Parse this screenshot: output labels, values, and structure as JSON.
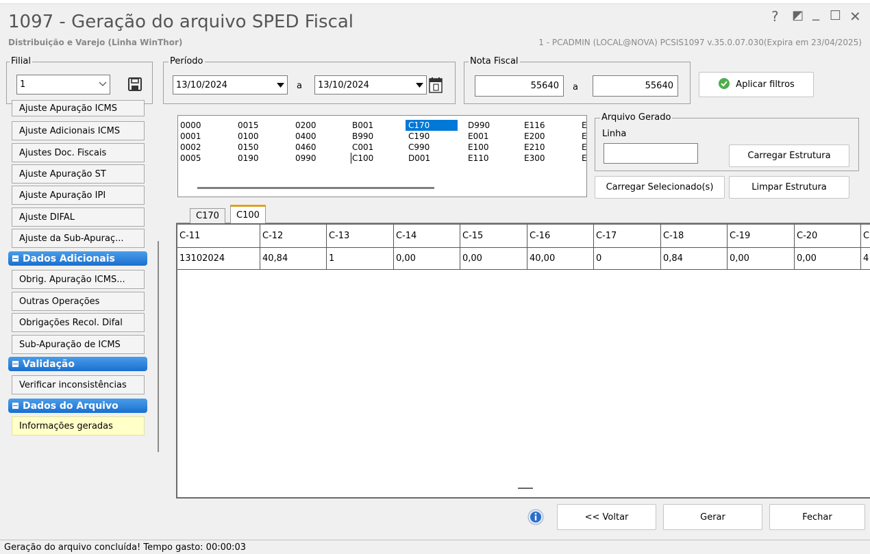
{
  "window": {
    "title": "1097 - Geração do arquivo SPED Fiscal",
    "subtitle": "Distribuição e Varejo (Linha WinThor)",
    "sysinfo": "1 - PCADMIN (LOCAL@NOVA)   PCSIS1097  v.35.0.07.030(Expira em 23/04/2025)",
    "controls": {
      "help": "?",
      "restore": "◩",
      "minimize": "_",
      "maximize": "☐",
      "close": "✕"
    }
  },
  "filial": {
    "legend": "Filial",
    "value": "1"
  },
  "periodo": {
    "legend": "Período",
    "start": "13/10/2024",
    "sep": "a",
    "end": "13/10/2024"
  },
  "nota": {
    "legend": "Nota Fiscal",
    "start": "55640",
    "sep": "a",
    "end": "55640"
  },
  "apply_button": "Aplicar filtros",
  "sidebar": {
    "items_top": [
      "Ajuste Apuração ICMS",
      "Ajuste Adicionais ICMS",
      "Ajustes Doc. Fiscais",
      "Ajuste Apuração ST",
      "Ajuste Apuração IPI",
      "Ajuste DIFAL",
      "Ajuste da Sub-Apuraç..."
    ],
    "head_adicionais": "Dados Adicionais",
    "items_adicionais": [
      "Obrig. Apuração ICMS...",
      "Outras Operações",
      "Obrigações Recol. Difal",
      "Sub-Apuração de ICMS"
    ],
    "head_validacao": "Validação",
    "item_validacao": "Verificar inconsistências",
    "head_arquivo": "Dados do Arquivo",
    "item_arquivo": "Informações geradas"
  },
  "records": {
    "columns": [
      [
        "0000",
        "0001",
        "0002",
        "0005"
      ],
      [
        "0015",
        "0100",
        "0150",
        "0190"
      ],
      [
        "0200",
        "0400",
        "0460",
        "0990"
      ],
      [
        "B001",
        "B990",
        "C001",
        "C100"
      ],
      [
        "C170",
        "C190",
        "C990",
        "D001"
      ],
      [
        "D990",
        "E001",
        "E100",
        "E110"
      ],
      [
        "E116",
        "E200",
        "E210",
        "E300"
      ],
      [
        "E",
        "E",
        "E",
        "E"
      ]
    ],
    "selected": "C170"
  },
  "arquivo_gerado": {
    "legend": "Arquivo Gerado",
    "linha_label": "Linha",
    "linha_value": ""
  },
  "buttons": {
    "carregar_estrutura": "Carregar Estrutura",
    "carregar_selecionados": "Carregar Selecionado(s)",
    "limpar_estrutura": "Limpar Estrutura",
    "voltar": "<< Voltar",
    "gerar": "Gerar",
    "fechar": "Fechar"
  },
  "tabs": [
    "C170",
    "C100"
  ],
  "grid": {
    "headers": [
      "C-11",
      "C-12",
      "C-13",
      "C-14",
      "C-15",
      "C-16",
      "C-17",
      "C-18",
      "C-19",
      "C-20",
      "C"
    ],
    "rows": [
      [
        "13102024",
        "40,84",
        "1",
        "0,00",
        "0,00",
        "40,00",
        "0",
        "0,84",
        "0,00",
        "0,00",
        "4"
      ]
    ]
  },
  "status": "Geração do arquivo concluída! Tempo gasto: 00:00:03",
  "colors": {
    "accent": "#1a6fd0",
    "selection": "#0078d7",
    "highlight_item": "#ffffc8"
  }
}
